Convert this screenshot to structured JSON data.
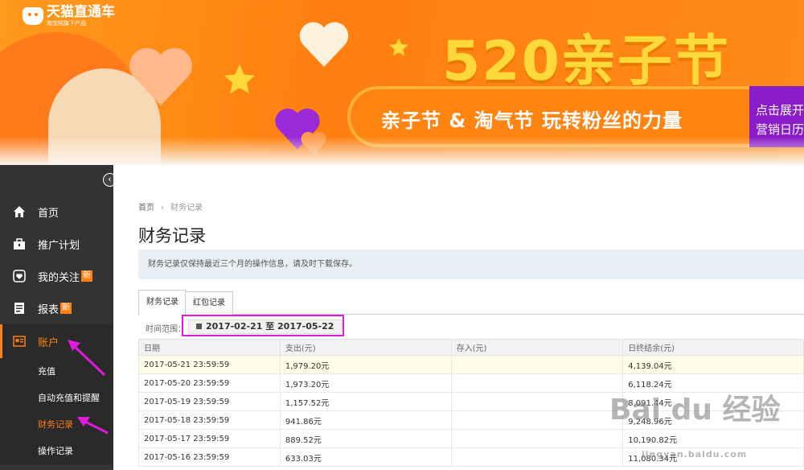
{
  "app": {
    "logo_name": "天猫直通车",
    "logo_sub": "淘宝网旗下产品"
  },
  "banner": {
    "title": "520亲子节",
    "slogan": "亲子节 & 淘气节 玩转粉丝的力量",
    "cta_line1": "点击展开",
    "cta_line2": "营销日历",
    "colors": {
      "orange": "#ff7f10",
      "yellow": "#ffd93a",
      "purple": "#8a1cc9"
    }
  },
  "sidebar": {
    "collapse_icon": "chevron-left-icon",
    "items": [
      {
        "label": "首页",
        "icon": "home-icon"
      },
      {
        "label": "推广计划",
        "icon": "briefcase-icon"
      },
      {
        "label": "我的关注",
        "icon": "heart-icon",
        "badge": "新"
      },
      {
        "label": "报表",
        "icon": "report-icon",
        "badge": "新"
      },
      {
        "label": "账户",
        "icon": "account-card-icon",
        "active": true
      }
    ],
    "sub_items": [
      {
        "label": "充值"
      },
      {
        "label": "自动充值和提醒"
      },
      {
        "label": "财务记录",
        "current": true
      },
      {
        "label": "操作记录"
      }
    ]
  },
  "main": {
    "breadcrumb": {
      "home": "首页",
      "current": "财务记录"
    },
    "title": "财务记录",
    "notice": "财务记录仅保持最近三个月的操作信息，请及时下载保存。",
    "tabs": [
      {
        "label": "财务记录"
      },
      {
        "label": "红包记录"
      }
    ],
    "filter": {
      "label": "时间范围：",
      "date_range": "2017-02-21 至 2017-05-22"
    },
    "table": {
      "headers": [
        "日期",
        "支出(元)",
        "存入(元)",
        "日终结余(元)"
      ],
      "rows": [
        [
          "2017-05-21 23:59:59",
          "1,979.20元",
          "",
          "4,139.04元"
        ],
        [
          "2017-05-20 23:59:59",
          "1,973.20元",
          "",
          "6,118.24元"
        ],
        [
          "2017-05-19 23:59:59",
          "1,157.52元",
          "",
          "8,091.44元"
        ],
        [
          "2017-05-18 23:59:59",
          "941.86元",
          "",
          "9,248.96元"
        ],
        [
          "2017-05-17 23:59:59",
          "889.52元",
          "",
          "10,190.82元"
        ],
        [
          "2017-05-16 23:59:59",
          "633.03元",
          "",
          "11,080.34元"
        ]
      ]
    }
  },
  "watermark": {
    "text": "Bai du 经验",
    "url": "jingyan.baidu.com"
  },
  "annotation_color": "#e01adb"
}
